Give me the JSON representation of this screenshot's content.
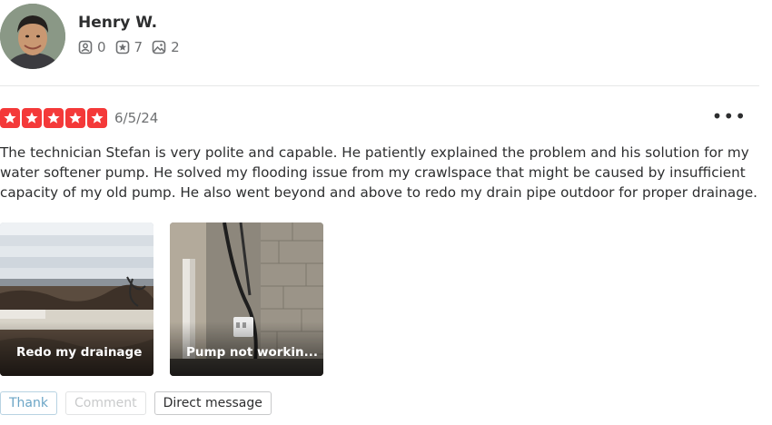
{
  "user": {
    "name": "Henry W.",
    "stats": {
      "friends": "0",
      "reviews": "7",
      "photos": "2"
    }
  },
  "review": {
    "rating": 5,
    "date": "6/5/24",
    "more_label": "•••",
    "text": "The technician Stefan is very polite and capable. He patiently explained the problem and his solution for my water softener pump. He solved my flooding issue from my crawlspace that might be caused by insufficient capacity of my old pump. He also went beyond and above to redo my drain pipe outdoor for proper drainage.",
    "photos": [
      {
        "caption": "Redo my drainage"
      },
      {
        "caption": "Pump not workin..."
      }
    ]
  },
  "actions": {
    "thank": "Thank",
    "comment": "Comment",
    "direct_message": "Direct message"
  },
  "colors": {
    "star_red": "#f43939",
    "text": "#2d2e2f",
    "muted": "#6e7072"
  }
}
